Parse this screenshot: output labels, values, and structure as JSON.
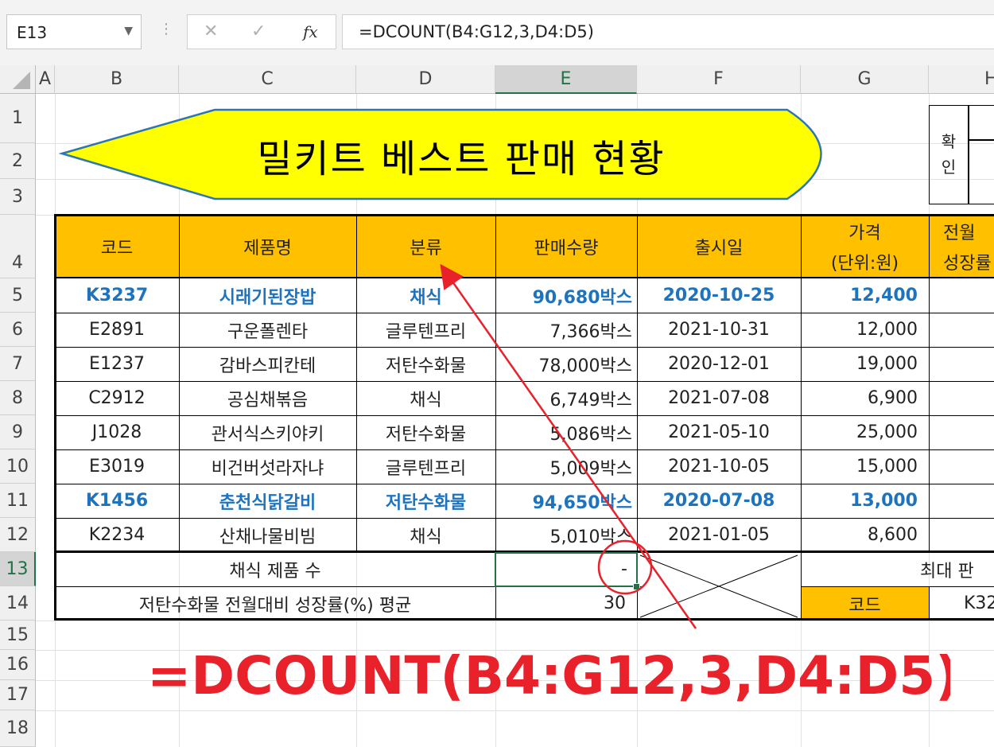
{
  "formula_bar": {
    "name_box": "E13",
    "formula": "=DCOUNT(B4:G12,3,D4:D5)",
    "fx_label": "fx"
  },
  "columns": [
    "A",
    "B",
    "C",
    "D",
    "E",
    "F",
    "G",
    "H"
  ],
  "rows": [
    "1",
    "2",
    "3",
    "4",
    "5",
    "6",
    "7",
    "8",
    "9",
    "10",
    "11",
    "12",
    "13",
    "14",
    "15",
    "16",
    "17",
    "18"
  ],
  "title": "밀키트 베스트 판매 현황",
  "approval": {
    "label_line1": "확",
    "label_line2": "인"
  },
  "table": {
    "headers": {
      "code": "코드",
      "name": "제품명",
      "category": "분류",
      "qty": "판매수량",
      "date": "출시일",
      "price_line1": "가격",
      "price_line2": "(단위:원)",
      "growth_line1": "전월",
      "growth_line2": "성장률"
    },
    "rows": [
      {
        "code": "K3237",
        "name": "시래기된장밥",
        "category": "채식",
        "qty": "90,680박스",
        "date": "2020-10-25",
        "price": "12,400",
        "highlight": true
      },
      {
        "code": "E2891",
        "name": "구운폴렌타",
        "category": "글루텐프리",
        "qty": "7,366박스",
        "date": "2021-10-31",
        "price": "12,000",
        "highlight": false
      },
      {
        "code": "E1237",
        "name": "감바스피칸테",
        "category": "저탄수화물",
        "qty": "78,000박스",
        "date": "2020-12-01",
        "price": "19,000",
        "highlight": false
      },
      {
        "code": "C2912",
        "name": "공심채볶음",
        "category": "채식",
        "qty": "6,749박스",
        "date": "2021-07-08",
        "price": "6,900",
        "highlight": false
      },
      {
        "code": "J1028",
        "name": "관서식스키야키",
        "category": "저탄수화물",
        "qty": "5,086박스",
        "date": "2021-05-10",
        "price": "25,000",
        "highlight": false
      },
      {
        "code": "E3019",
        "name": "비건버섯라자냐",
        "category": "글루텐프리",
        "qty": "5,009박스",
        "date": "2021-10-05",
        "price": "15,000",
        "highlight": false
      },
      {
        "code": "K1456",
        "name": "춘천식닭갈비",
        "category": "저탄수화물",
        "qty": "94,650박스",
        "date": "2020-07-08",
        "price": "13,000",
        "highlight": true
      },
      {
        "code": "K2234",
        "name": "산채나물비빔",
        "category": "채식",
        "qty": "5,010박스",
        "date": "2021-01-05",
        "price": "8,600",
        "highlight": false
      }
    ],
    "summary": {
      "row13_label": "채식 제품 수",
      "row13_value": "-",
      "row14_label": "저탄수화물 전월대비 성장률(%) 평균",
      "row14_value": "30",
      "max_label": "최대 판",
      "code_label": "코드",
      "code_value": "K32"
    }
  },
  "annotation": {
    "formula": "=DCOUNT(B4:G12,3,D4:D5)",
    "color": "#e8212a"
  },
  "colors": {
    "header_fill": "#ffc000",
    "title_fill": "#ffff00",
    "highlight_text": "#1e73be",
    "selection": "#217346"
  }
}
